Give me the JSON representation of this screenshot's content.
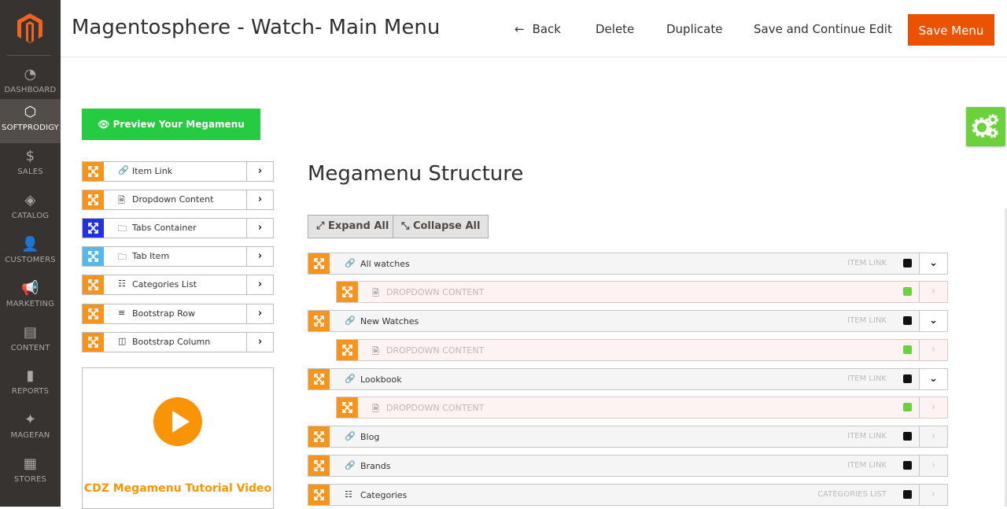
{
  "sidebar": {
    "items": [
      {
        "label": "DASHBOARD",
        "icon": "dashboard-icon",
        "glyph": "◔"
      },
      {
        "label": "SOFTPRODIGY",
        "icon": "hexagon-icon",
        "glyph": "⬡",
        "active": true
      },
      {
        "label": "SALES",
        "icon": "dollar-icon",
        "glyph": "$"
      },
      {
        "label": "CATALOG",
        "icon": "box-icon",
        "glyph": "◈"
      },
      {
        "label": "CUSTOMERS",
        "icon": "person-icon",
        "glyph": "👤"
      },
      {
        "label": "MARKETING",
        "icon": "megaphone-icon",
        "glyph": "📢"
      },
      {
        "label": "CONTENT",
        "icon": "layout-icon",
        "glyph": "▤"
      },
      {
        "label": "REPORTS",
        "icon": "bar-chart-icon",
        "glyph": "▮"
      },
      {
        "label": "MAGEFAN",
        "icon": "magefan-icon",
        "glyph": "✦"
      },
      {
        "label": "STORES",
        "icon": "store-icon",
        "glyph": "▦"
      }
    ]
  },
  "header": {
    "title": "Magentosphere - Watch- Main Menu",
    "back": "Back",
    "delete": "Delete",
    "duplicate": "Duplicate",
    "save_continue": "Save and Continue Edit",
    "save_menu": "Save Menu"
  },
  "colors": {
    "accent": "#eb5202",
    "orange": "#f7941d",
    "green": "#25cb40",
    "sidebar": "#373330"
  },
  "preview_button": "Preview Your Megamenu",
  "tools": [
    {
      "label": "Item Link",
      "icon": "link-icon",
      "glyph": "🔗",
      "handle": "orange"
    },
    {
      "label": "Dropdown Content",
      "icon": "file-icon",
      "glyph": "🗎",
      "handle": "orange"
    },
    {
      "label": "Tabs Container",
      "icon": "folder-icon",
      "glyph": "🗀",
      "handle": "blue"
    },
    {
      "label": "Tab Item",
      "icon": "folder-icon",
      "glyph": "🗀",
      "handle": "lblue"
    },
    {
      "label": "Categories List",
      "icon": "list-icon",
      "glyph": "☷",
      "handle": "orange"
    },
    {
      "label": "Bootstrap Row",
      "icon": "rows-icon",
      "glyph": "≡",
      "handle": "orange"
    },
    {
      "label": "Bootstrap Column",
      "icon": "column-icon",
      "glyph": "◫",
      "handle": "orange"
    }
  ],
  "video": {
    "title": "CDZ Megamenu Tutorial Video"
  },
  "structure": {
    "title": "Megamenu Structure",
    "expand_all": "Expand All",
    "collapse_all": "Collapse All",
    "rows": [
      {
        "label": "All watches",
        "tag": "ITEM LINK",
        "sub": false,
        "expanded": true
      },
      {
        "label": "DROPDOWN CONTENT",
        "tag": "",
        "sub": true,
        "expanded": false
      },
      {
        "label": "New Watches",
        "tag": "ITEM LINK",
        "sub": false,
        "expanded": true
      },
      {
        "label": "DROPDOWN CONTENT",
        "tag": "",
        "sub": true,
        "expanded": false
      },
      {
        "label": "Lookbook",
        "tag": "ITEM LINK",
        "sub": false,
        "expanded": true
      },
      {
        "label": "DROPDOWN CONTENT",
        "tag": "",
        "sub": true,
        "expanded": false
      },
      {
        "label": "Blog",
        "tag": "ITEM LINK",
        "sub": false,
        "expanded": false
      },
      {
        "label": "Brands",
        "tag": "ITEM LINK",
        "sub": false,
        "expanded": false
      },
      {
        "label": "Categories",
        "tag": "CATEGORIES LIST",
        "sub": false,
        "expanded": false
      }
    ]
  }
}
